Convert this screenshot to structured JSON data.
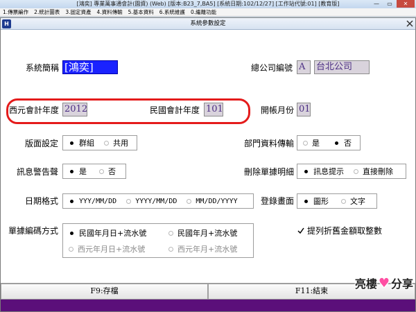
{
  "window": {
    "title": "[鴻奕] 專業萬事通會計(園資) (Web) [版本:B23_7,BA5] [系統日期:102/12/27] [工作站代號:01] [教育版]",
    "min_label": "—",
    "max_label": "▭",
    "close_label": "✕"
  },
  "menu": [
    "1.傳票編作",
    "2.統計圖表",
    "3.固定資產",
    "4.資料傳輸",
    "5.基本資料",
    "6.系統維護",
    "0.繼離功能"
  ],
  "form": {
    "app_logo": "H",
    "title": "系統參數設定",
    "system_abbrev": {
      "label": "系統簡稱",
      "value": "[鴻奕]"
    },
    "hq_code": {
      "label": "總公司編號",
      "code": "A",
      "name": "台北公司"
    },
    "ad_fiscal_year": {
      "label": "西元會計年度",
      "value": "2012"
    },
    "roc_fiscal_year": {
      "label": "民國會計年度",
      "value": "101"
    },
    "open_month": {
      "label": "開帳月份",
      "value": "01"
    },
    "layout_setting": {
      "label": "版面設定",
      "options": [
        "群組",
        "共用"
      ],
      "selected": 0
    },
    "dept_transfer": {
      "label": "部門資料傳輸",
      "options": [
        "是",
        "否"
      ],
      "selected": 1
    },
    "alert_sound": {
      "label": "訊息警告聲",
      "options": [
        "是",
        "否"
      ],
      "selected": 0
    },
    "delete_detail": {
      "label": "刪除單據明細",
      "options": [
        "訊息提示",
        "直接刪除"
      ],
      "selected": 0
    },
    "date_format": {
      "label": "日期格式",
      "options": [
        "YYY/MM/DD",
        "YYYY/MM/DD",
        "MM/DD/YYYY"
      ],
      "selected": 0
    },
    "login_screen": {
      "label": "登錄畫面",
      "options": [
        "圖形",
        "文字"
      ],
      "selected": 0
    },
    "doc_numbering": {
      "label": "單據編碼方式",
      "options": [
        "民國年月日+流水號",
        "民國年月+流水號",
        "西元年月日+流水號",
        "西元年月+流水號"
      ],
      "selected": 0
    },
    "round_discount": {
      "label": "提列折舊金額取整數",
      "checked": true
    }
  },
  "footer": {
    "f9_label": "F9:存檔",
    "f11_label": "F11:結束"
  },
  "watermark": {
    "left": "亮樓",
    "right": "分享"
  },
  "colors": {
    "active_field": "#1a22ff",
    "highlight": "#e41b1b",
    "status_bar": "#5b0f7a"
  }
}
